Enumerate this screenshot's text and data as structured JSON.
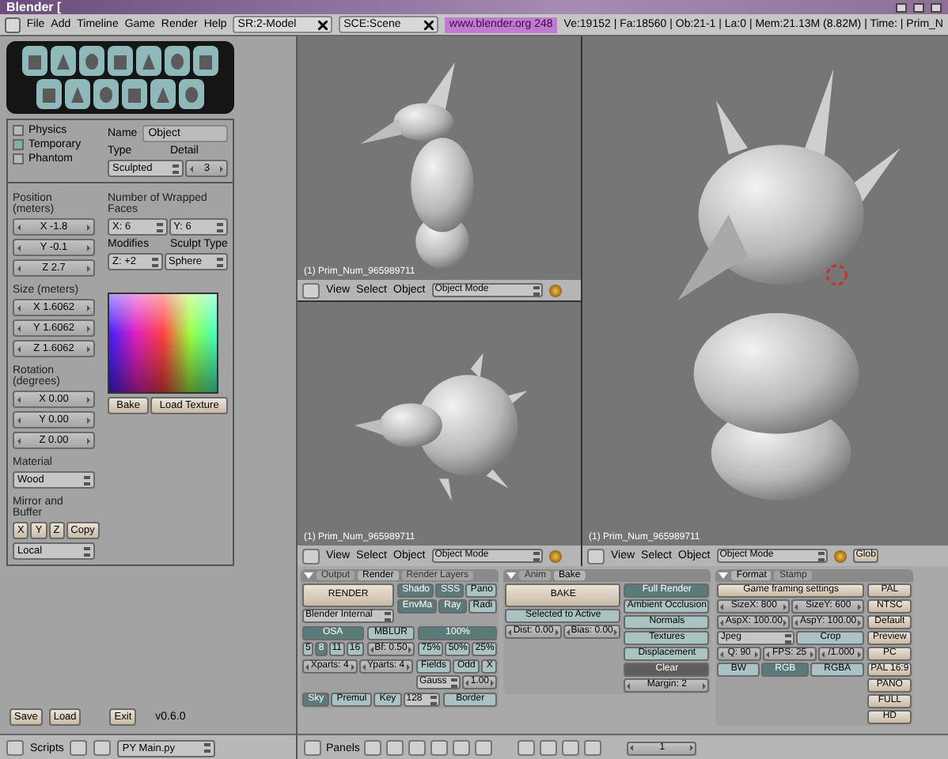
{
  "window": {
    "title": "Blender ["
  },
  "menu_bar": {
    "menus": [
      "File",
      "Add",
      "Timeline",
      "Game",
      "Render",
      "Help"
    ],
    "screen": "SR:2-Model",
    "scene": "SCE:Scene",
    "url": "www.blender.org 248",
    "stats": "Ve:19152 | Fa:18560 | Ob:21-1 | La:0 | Mem:21.13M (8.82M) | Time: | Prim_N"
  },
  "script_panel": {
    "options": [
      {
        "label": "Physics",
        "checked": false
      },
      {
        "label": "Temporary",
        "checked": true
      },
      {
        "label": "Phantom",
        "checked": false
      }
    ],
    "name_label": "Name",
    "name_value": "Object",
    "type_label": "Type",
    "type_value": "Sculpted",
    "detail_label": "Detail",
    "detail_value": "3",
    "position": {
      "label": "Position (meters)",
      "values": [
        "X -1.8",
        "Y -0.1",
        "Z 2.7"
      ]
    },
    "size": {
      "label": "Size (meters)",
      "values": [
        "X 1.6062",
        "Y 1.6062",
        "Z 1.6062"
      ]
    },
    "rotation": {
      "label": "Rotation (degrees)",
      "values": [
        "X 0.00",
        "Y 0.00",
        "Z 0.00"
      ]
    },
    "wrapped": {
      "label": "Number of Wrapped Faces",
      "x": "X: 6",
      "y": "Y: 6",
      "modifies_label": "Modifies",
      "modifies": "Z: +2",
      "sculpt_type_label": "Sculpt Type",
      "sculpt_type": "Sphere"
    },
    "texture_buttons": [
      "Bake",
      "Load Texture"
    ],
    "material": {
      "label": "Material",
      "value": "Wood"
    },
    "mirror": {
      "label": "Mirror and Buffer",
      "axes": [
        "X",
        "Y",
        "Z"
      ],
      "copy": "Copy",
      "space": "Local"
    },
    "footer": {
      "buttons": [
        "Save",
        "Load",
        "Exit"
      ],
      "version": "v0.6.0"
    }
  },
  "script_header": {
    "menu": "Scripts",
    "script": "PY Main.py"
  },
  "viewports": [
    {
      "kind": "side",
      "label": "(1) Prim_Num_965989711",
      "menus": [
        "View",
        "Select",
        "Object"
      ],
      "mode": "Object Mode"
    },
    {
      "kind": "top",
      "label": "(1) Prim_Num_965989711",
      "menus": [
        "View",
        "Select",
        "Object"
      ],
      "mode": "Object Mode"
    },
    {
      "kind": "perspective",
      "label": "(1) Prim_Num_965989711",
      "menus": [
        "View",
        "Select",
        "Object"
      ],
      "mode": "Object Mode",
      "extra": "Glob"
    }
  ],
  "buttons_window": {
    "panels": [
      {
        "tabs": [
          {
            "text": "Output",
            "selected": false
          },
          {
            "text": "Render",
            "selected": true
          },
          {
            "text": "Render Layers",
            "selected": false
          }
        ],
        "rows": [
          [
            [
              [
                {
                  "kind": "big",
                  "text": "RENDER"
                }
              ],
              [
                {
                  "kind": "menu",
                  "text": "Blender Internal"
                }
              ]
            ],
            [
              [
                {
                  "kind": "toggle",
                  "text": "Shado",
                  "selected": true
                },
                {
                  "kind": "toggle",
                  "text": "SSS",
                  "selected": true
                },
                {
                  "kind": "toggle",
                  "text": "Pano",
                  "selected": false
                }
              ],
              [
                {
                  "kind": "toggle",
                  "text": "EnvMa",
                  "selected": true
                },
                {
                  "kind": "toggle",
                  "text": "Ray",
                  "selected": true
                },
                {
                  "kind": "toggle",
                  "text": "Radi",
                  "selected": false
                }
              ]
            ]
          ],
          [
            [
              [
                {
                  "kind": "toggle",
                  "text": "OSA",
                  "selected": true
                }
              ],
              [
                {
                  "kind": "toggle",
                  "text": "5",
                  "selected": false
                },
                {
                  "kind": "toggle",
                  "text": "8",
                  "selected": true
                },
                {
                  "kind": "toggle",
                  "text": "11",
                  "selected": false
                },
                {
                  "kind": "toggle",
                  "text": "16",
                  "selected": false
                }
              ]
            ],
            [
              [
                {
                  "kind": "toggle",
                  "text": "MBLUR",
                  "selected": false
                }
              ],
              [
                {
                  "kind": "num",
                  "text": "Bf: 0.50"
                }
              ]
            ],
            [
              [
                {
                  "kind": "toggle",
                  "text": "100%",
                  "selected": true
                }
              ],
              [
                {
                  "kind": "toggle",
                  "text": "75%",
                  "selected": false
                },
                {
                  "kind": "toggle",
                  "text": "50%",
                  "selected": false
                },
                {
                  "kind": "toggle",
                  "text": "25%",
                  "selected": false
                }
              ]
            ]
          ],
          [
            [
              [
                {
                  "kind": "num",
                  "text": "Xparts: 4"
                },
                {
                  "kind": "num",
                  "text": "Yparts: 4"
                }
              ]
            ],
            [
              [
                {
                  "kind": "toggle",
                  "text": "Fields",
                  "selected": false
                },
                {
                  "kind": "toggle",
                  "text": "Odd",
                  "selected": false
                },
                {
                  "kind": "toggle",
                  "text": "X",
                  "selected": false
                }
              ],
              [
                {
                  "kind": "menu",
                  "text": "Gauss"
                },
                {
                  "kind": "num",
                  "text": "1.00"
                }
              ]
            ]
          ],
          [
            [
              [
                {
                  "kind": "toggle",
                  "text": "Sky",
                  "selected": true
                },
                {
                  "kind": "toggle",
                  "text": "Premul",
                  "selected": false
                },
                {
                  "kind": "toggle",
                  "text": "Key",
                  "selected": false
                },
                {
                  "kind": "menu",
                  "text": "128"
                }
              ]
            ],
            [
              [
                {
                  "kind": "toggle",
                  "text": "Border",
                  "selected": false
                }
              ]
            ]
          ]
        ]
      },
      {
        "tabs": [
          {
            "text": "Anim",
            "selected": false
          },
          {
            "text": "Bake",
            "selected": true
          }
        ],
        "rows": [
          [
            [
              [
                {
                  "kind": "big",
                  "text": "BAKE"
                }
              ],
              [
                {
                  "kind": "toggle",
                  "text": "Selected to Active",
                  "selected": false
                }
              ],
              [
                {
                  "kind": "num",
                  "text": "Dist: 0.00"
                },
                {
                  "kind": "num",
                  "text": "Bias: 0.00"
                }
              ]
            ],
            [
              [
                {
                  "kind": "toggle",
                  "text": "Full Render",
                  "selected": true
                }
              ],
              [
                {
                  "kind": "toggle",
                  "text": "Ambient Occlusion",
                  "selected": false
                }
              ],
              [
                {
                  "kind": "toggle",
                  "text": "Normals",
                  "selected": false
                }
              ],
              [
                {
                  "kind": "toggle",
                  "text": "Textures",
                  "selected": false
                }
              ],
              [
                {
                  "kind": "toggle",
                  "text": "Displacement",
                  "selected": false
                }
              ],
              [
                {
                  "kind": "dark",
                  "text": "Clear"
                }
              ],
              [
                {
                  "kind": "num",
                  "text": "Margin: 2"
                }
              ]
            ]
          ]
        ]
      },
      {
        "tabs": [
          {
            "text": "Format",
            "selected": true
          },
          {
            "text": "Stamp",
            "selected": false
          }
        ],
        "rows": [
          [
            [
              [
                {
                  "kind": "button",
                  "text": "Game framing settings"
                }
              ],
              [
                {
                  "kind": "num",
                  "text": "SizeX: 800"
                },
                {
                  "kind": "num",
                  "text": "SizeY: 600"
                }
              ],
              [
                {
                  "kind": "num",
                  "text": "AspX: 100.00"
                },
                {
                  "kind": "num",
                  "text": "AspY: 100.00"
                }
              ],
              [
                {
                  "kind": "menu",
                  "text": "Jpeg"
                },
                {
                  "kind": "toggle",
                  "text": "Crop",
                  "selected": false
                }
              ],
              [
                {
                  "kind": "num",
                  "text": "Q: 90"
                },
                {
                  "kind": "num",
                  "text": "FPS: 25"
                },
                {
                  "kind": "num",
                  "text": "/1.000"
                }
              ],
              [
                {
                  "kind": "toggle",
                  "text": "BW",
                  "selected": false
                },
                {
                  "kind": "toggle",
                  "text": "RGB",
                  "selected": true
                },
                {
                  "kind": "toggle",
                  "text": "RGBA",
                  "selected": false
                }
              ]
            ],
            [
              [
                {
                  "kind": "button",
                  "text": "PAL"
                }
              ],
              [
                {
                  "kind": "button",
                  "text": "NTSC"
                }
              ],
              [
                {
                  "kind": "button",
                  "text": "Default"
                }
              ],
              [
                {
                  "kind": "button",
                  "text": "Preview"
                }
              ],
              [
                {
                  "kind": "button",
                  "text": "PC"
                }
              ],
              [
                {
                  "kind": "button",
                  "text": "PAL 16:9"
                }
              ],
              [
                {
                  "kind": "button",
                  "text": "PANO"
                }
              ],
              [
                {
                  "kind": "button",
                  "text": "FULL"
                }
              ],
              [
                {
                  "kind": "button",
                  "text": "HD"
                }
              ]
            ]
          ]
        ]
      }
    ],
    "header": {
      "label": "Panels",
      "frame": "1"
    }
  }
}
